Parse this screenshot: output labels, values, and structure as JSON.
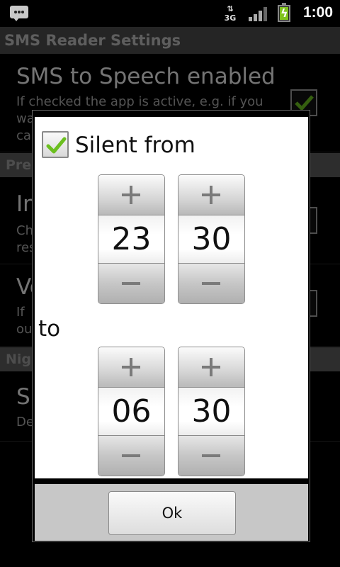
{
  "status_bar": {
    "network": "3G",
    "time": "1:00",
    "icons": [
      "message-notification-icon",
      "3g-data-icon",
      "signal-strength-icon",
      "battery-charging-icon"
    ]
  },
  "app": {
    "title": "SMS Reader Settings",
    "preferences": [
      {
        "title": "SMS to Speech enabled",
        "summary": "If checked the app is active, e.g. if you"
      },
      {
        "title": "In"
      },
      {
        "title": "Vo"
      },
      {
        "title": "Si"
      }
    ],
    "categories": [
      "Pre",
      "Nig"
    ],
    "fragments": {
      "ch": "Ch",
      "res": "res",
      "if": "If",
      "ou": "ou",
      "de": "De",
      "wa": "wa",
      "ca": "ca"
    }
  },
  "dialog": {
    "silent_label": "Silent from",
    "silent_checked": true,
    "to_label": "to",
    "from_hour": "23",
    "from_minute": "30",
    "to_hour": "06",
    "to_minute": "30",
    "ok_label": "Ok"
  },
  "colors": {
    "check_green": "#6bbf1f",
    "battery_green": "#7fc31c"
  }
}
